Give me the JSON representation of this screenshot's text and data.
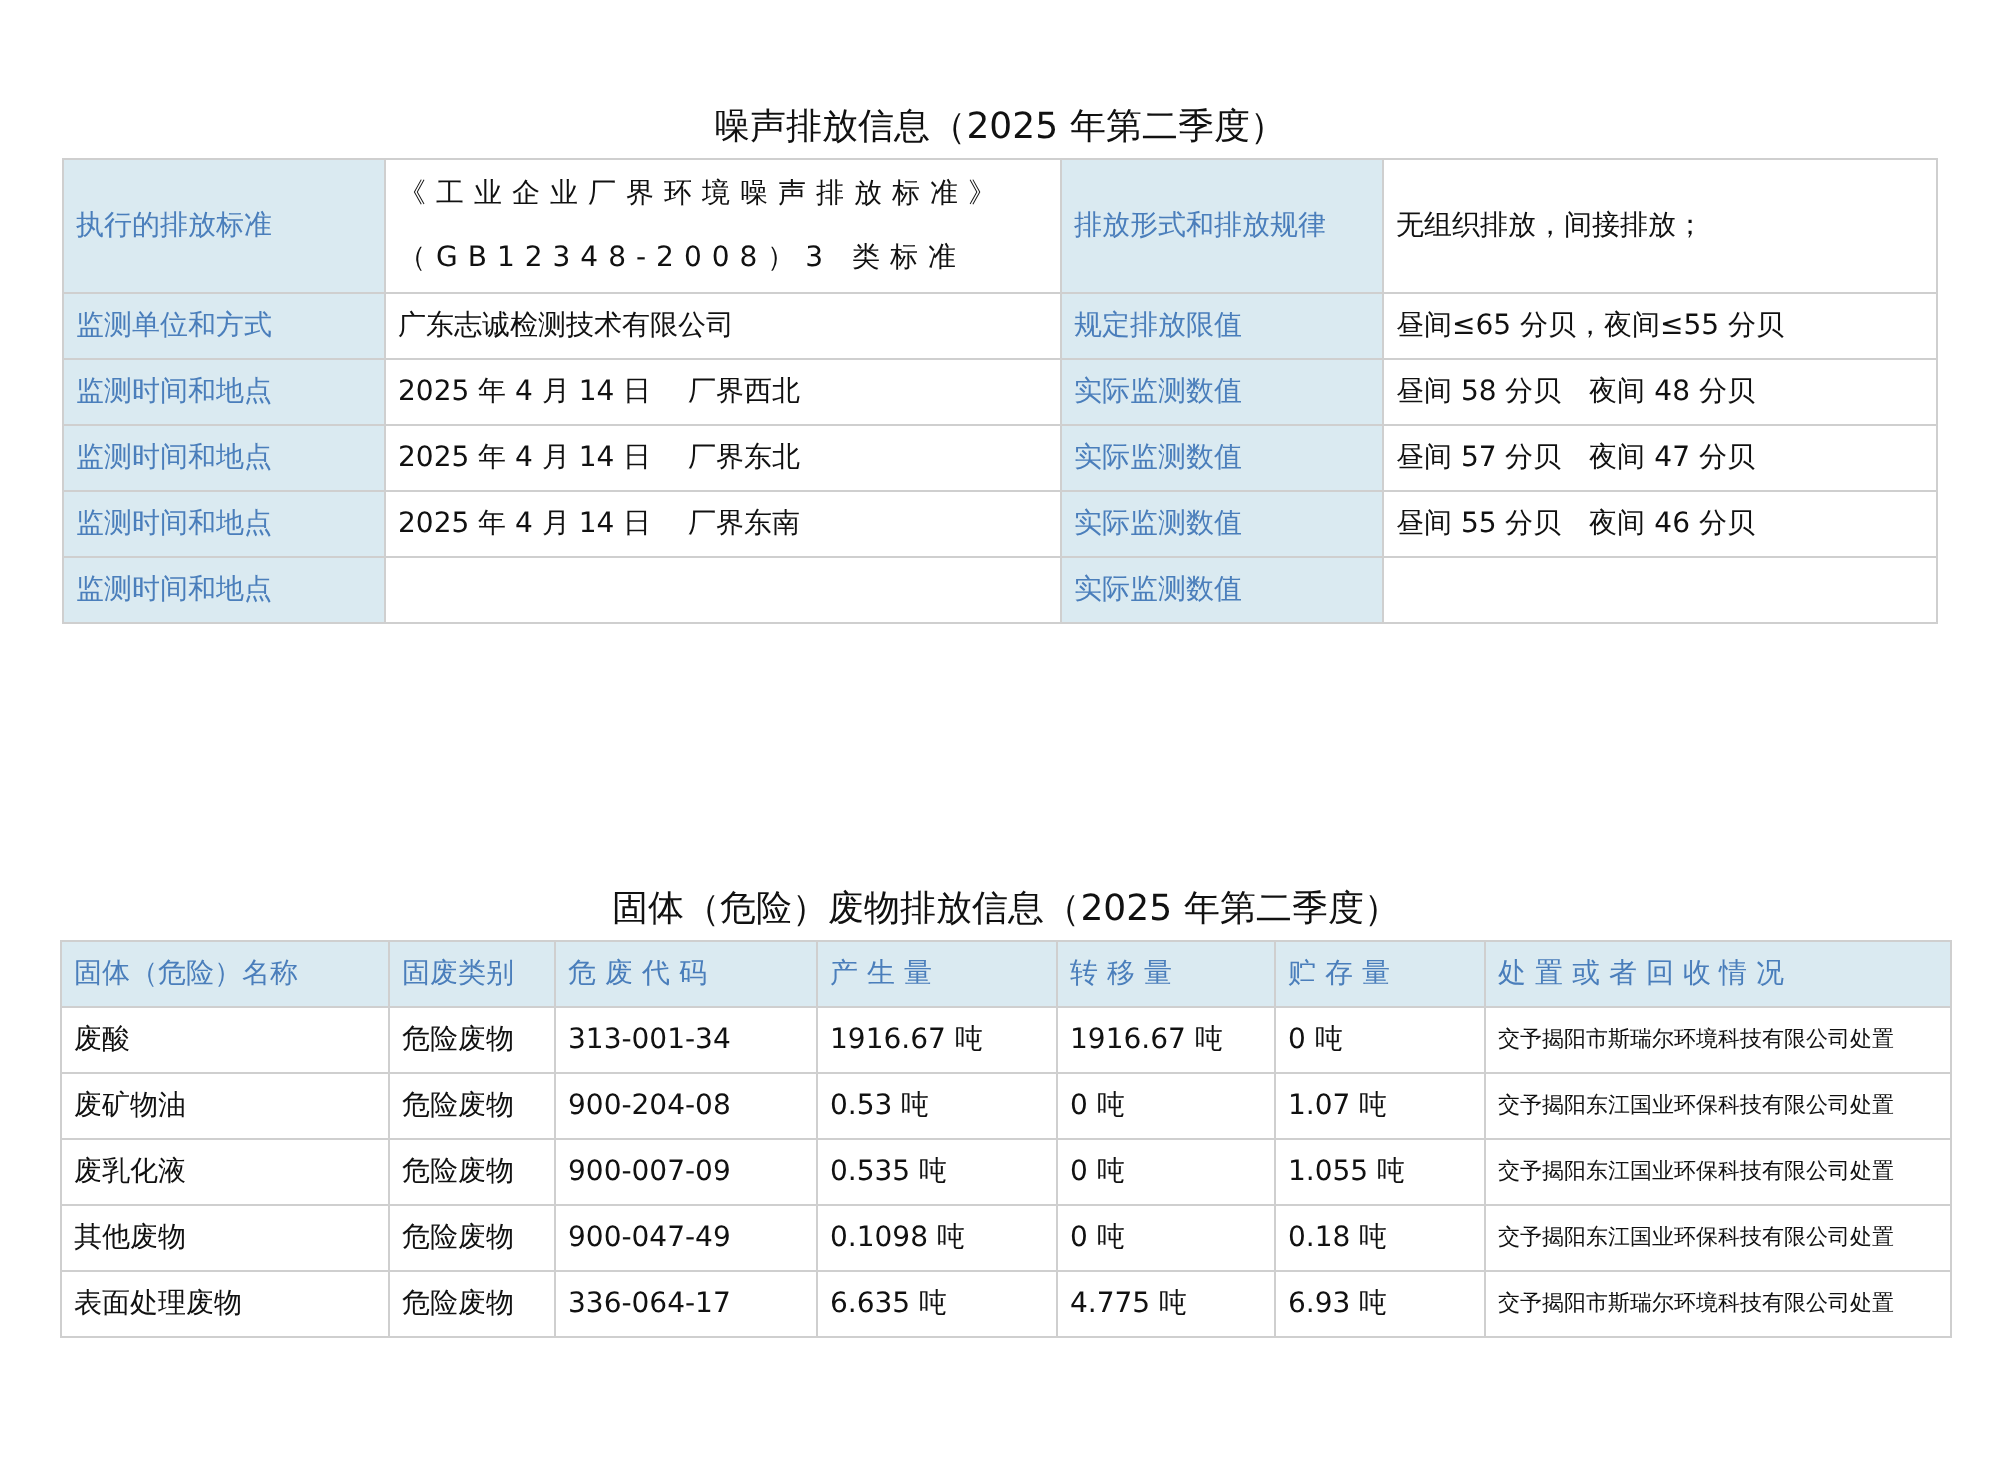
{
  "noise_section": {
    "title": "噪声排放信息（2025 年第二季度）",
    "rows": [
      {
        "cells": [
          {
            "kind": "label",
            "text": "执行的排放标准"
          },
          {
            "kind": "value",
            "text": "《工业企业厂界环境噪声排放标准》（GB12348-2008）3 类标准"
          },
          {
            "kind": "label",
            "text": "排放形式和排放规律"
          },
          {
            "kind": "value",
            "text": "无组织排放，间接排放；"
          }
        ]
      },
      {
        "cells": [
          {
            "kind": "label",
            "text": "监测单位和方式"
          },
          {
            "kind": "value",
            "text": "广东志诚检测技术有限公司"
          },
          {
            "kind": "label",
            "text": "规定排放限值"
          },
          {
            "kind": "value",
            "text": "昼间≤65 分贝，夜间≤55 分贝"
          }
        ]
      },
      {
        "cells": [
          {
            "kind": "label",
            "text": "监测时间和地点"
          },
          {
            "kind": "value",
            "text": "2025 年 4 月 14 日　 厂界西北"
          },
          {
            "kind": "label",
            "text": "实际监测数值"
          },
          {
            "kind": "value",
            "text": "昼间 58 分贝　夜间 48 分贝"
          }
        ]
      },
      {
        "cells": [
          {
            "kind": "label",
            "text": "监测时间和地点"
          },
          {
            "kind": "value",
            "text": "2025 年 4 月 14 日　 厂界东北"
          },
          {
            "kind": "label",
            "text": "实际监测数值"
          },
          {
            "kind": "value",
            "text": "昼间 57 分贝　夜间 47 分贝"
          }
        ]
      },
      {
        "cells": [
          {
            "kind": "label",
            "text": "监测时间和地点"
          },
          {
            "kind": "value",
            "text": "2025 年 4 月 14 日　 厂界东南"
          },
          {
            "kind": "label",
            "text": "实际监测数值"
          },
          {
            "kind": "value",
            "text": "昼间 55 分贝　夜间 46 分贝"
          }
        ]
      },
      {
        "cells": [
          {
            "kind": "label",
            "text": "监测时间和地点"
          },
          {
            "kind": "value",
            "text": ""
          },
          {
            "kind": "label",
            "text": "实际监测数值"
          },
          {
            "kind": "value",
            "text": ""
          }
        ]
      }
    ]
  },
  "waste_section": {
    "title": "固体（危险）废物排放信息（2025 年第二季度）",
    "columns": [
      "固体（危险）名称",
      "固废类别",
      "危 废 代 码",
      "产 生 量",
      "转 移 量",
      "贮 存 量",
      "处 置 或 者 回 收 情 况"
    ],
    "rows": [
      [
        "废酸",
        "危险废物",
        "313-001-34",
        "1916.67 吨",
        "1916.67 吨",
        "0 吨",
        "交予揭阳市斯瑞尔环境科技有限公司处置"
      ],
      [
        "废矿物油",
        "危险废物",
        "900-204-08",
        "0.53 吨",
        "0 吨",
        "1.07 吨",
        "交予揭阳东江国业环保科技有限公司处置"
      ],
      [
        "废乳化液",
        "危险废物",
        "900-007-09",
        "0.535 吨",
        "0 吨",
        "1.055 吨",
        "交予揭阳东江国业环保科技有限公司处置"
      ],
      [
        "其他废物",
        "危险废物",
        "900-047-49",
        "0.1098 吨",
        "0 吨",
        "0.18 吨",
        "交予揭阳东江国业环保科技有限公司处置"
      ],
      [
        "表面处理废物",
        "危险废物",
        "336-064-17",
        "6.635 吨",
        "4.775 吨",
        "6.93 吨",
        "交予揭阳市斯瑞尔环境科技有限公司处置"
      ]
    ]
  }
}
